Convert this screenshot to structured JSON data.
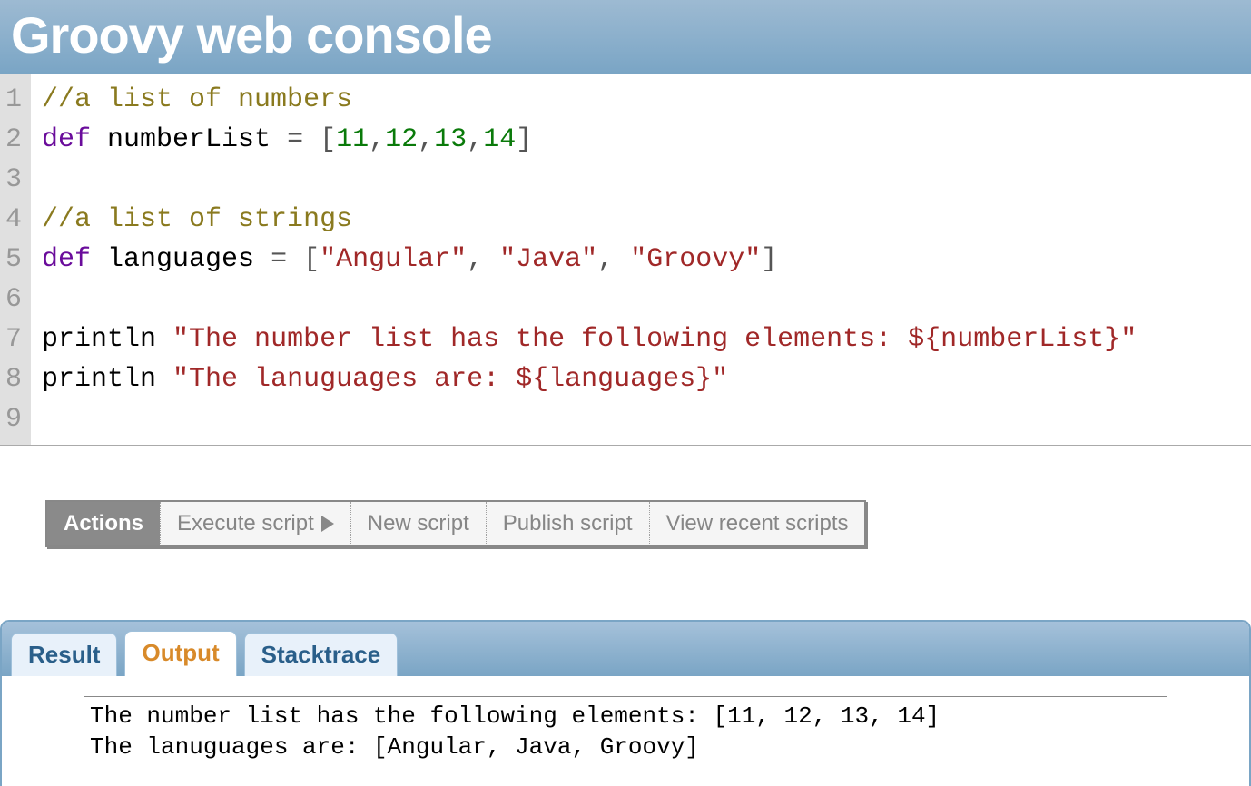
{
  "header": {
    "title": "Groovy web console"
  },
  "editor": {
    "line_numbers": [
      "1",
      "2",
      "3",
      "4",
      "5",
      "6",
      "7",
      "8",
      "9"
    ],
    "lines": [
      [
        {
          "cls": "tok-comment",
          "t": "//a list of numbers"
        }
      ],
      [
        {
          "cls": "tok-keyword",
          "t": "def"
        },
        {
          "cls": "tok-ident",
          "t": " numberList "
        },
        {
          "cls": "tok-punct",
          "t": "= ["
        },
        {
          "cls": "tok-number",
          "t": "11"
        },
        {
          "cls": "tok-punct",
          "t": ","
        },
        {
          "cls": "tok-number",
          "t": "12"
        },
        {
          "cls": "tok-punct",
          "t": ","
        },
        {
          "cls": "tok-number",
          "t": "13"
        },
        {
          "cls": "tok-punct",
          "t": ","
        },
        {
          "cls": "tok-number",
          "t": "14"
        },
        {
          "cls": "tok-punct",
          "t": "]"
        }
      ],
      [
        {
          "cls": "tok-ident",
          "t": " "
        }
      ],
      [
        {
          "cls": "tok-comment",
          "t": "//a list of strings"
        }
      ],
      [
        {
          "cls": "tok-keyword",
          "t": "def"
        },
        {
          "cls": "tok-ident",
          "t": " languages "
        },
        {
          "cls": "tok-punct",
          "t": "= ["
        },
        {
          "cls": "tok-string",
          "t": "\"Angular\""
        },
        {
          "cls": "tok-punct",
          "t": ", "
        },
        {
          "cls": "tok-string",
          "t": "\"Java\""
        },
        {
          "cls": "tok-punct",
          "t": ", "
        },
        {
          "cls": "tok-string",
          "t": "\"Groovy\""
        },
        {
          "cls": "tok-punct",
          "t": "]"
        }
      ],
      [
        {
          "cls": "tok-ident",
          "t": " "
        }
      ],
      [
        {
          "cls": "tok-ident",
          "t": "println "
        },
        {
          "cls": "tok-string",
          "t": "\"The number list has the following elements: ${numberList}\""
        }
      ],
      [
        {
          "cls": "tok-ident",
          "t": "println "
        },
        {
          "cls": "tok-string",
          "t": "\"The lanuguages are: ${languages}\""
        }
      ],
      [
        {
          "cls": "tok-ident",
          "t": " "
        }
      ]
    ]
  },
  "actions": {
    "label": "Actions",
    "items": [
      {
        "label": "Execute script",
        "icon": "play"
      },
      {
        "label": "New script"
      },
      {
        "label": "Publish script"
      },
      {
        "label": "View recent scripts"
      }
    ]
  },
  "tabs": {
    "items": [
      {
        "label": "Result",
        "active": false
      },
      {
        "label": "Output",
        "active": true
      },
      {
        "label": "Stacktrace",
        "active": false
      }
    ]
  },
  "output": {
    "text": "The number list has the following elements: [11, 12, 13, 14]\nThe lanuguages are: [Angular, Java, Groovy]"
  }
}
